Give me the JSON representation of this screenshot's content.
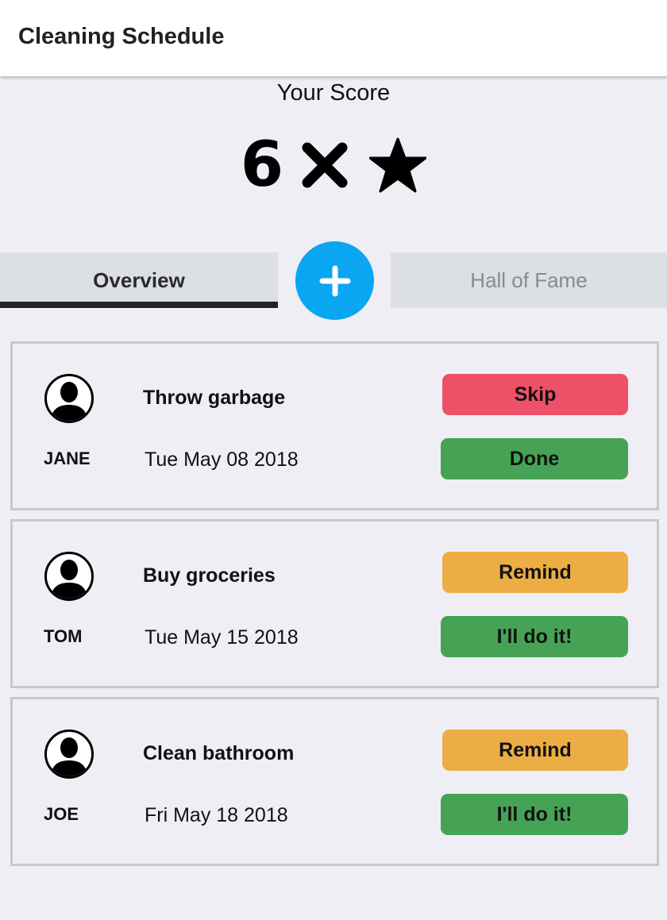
{
  "appbar": {
    "title": "Cleaning Schedule"
  },
  "score": {
    "label": "Your Score",
    "value": "6",
    "multiplier_icon": "times-icon",
    "unit_icon": "star-icon"
  },
  "tabs": [
    {
      "label": "Overview",
      "active": true
    },
    {
      "label": "Hall of Fame",
      "active": false
    }
  ],
  "fab": {
    "icon": "plus-icon",
    "color": "#0aa6f2"
  },
  "colors": {
    "skip": "#ee5068",
    "remind": "#ecad44",
    "done": "#46a356"
  },
  "tasks": [
    {
      "person": "JANE",
      "task": "Throw garbage",
      "date": "Tue May 08 2018",
      "action_top": "Skip",
      "action_bottom": "Done"
    },
    {
      "person": "TOM",
      "task": "Buy groceries",
      "date": "Tue May 15 2018",
      "action_top": "Remind",
      "action_bottom": "I'll do it!"
    },
    {
      "person": "JOE",
      "task": "Clean bathroom",
      "date": "Fri May 18 2018",
      "action_top": "Remind",
      "action_bottom": "I'll do it!"
    }
  ]
}
